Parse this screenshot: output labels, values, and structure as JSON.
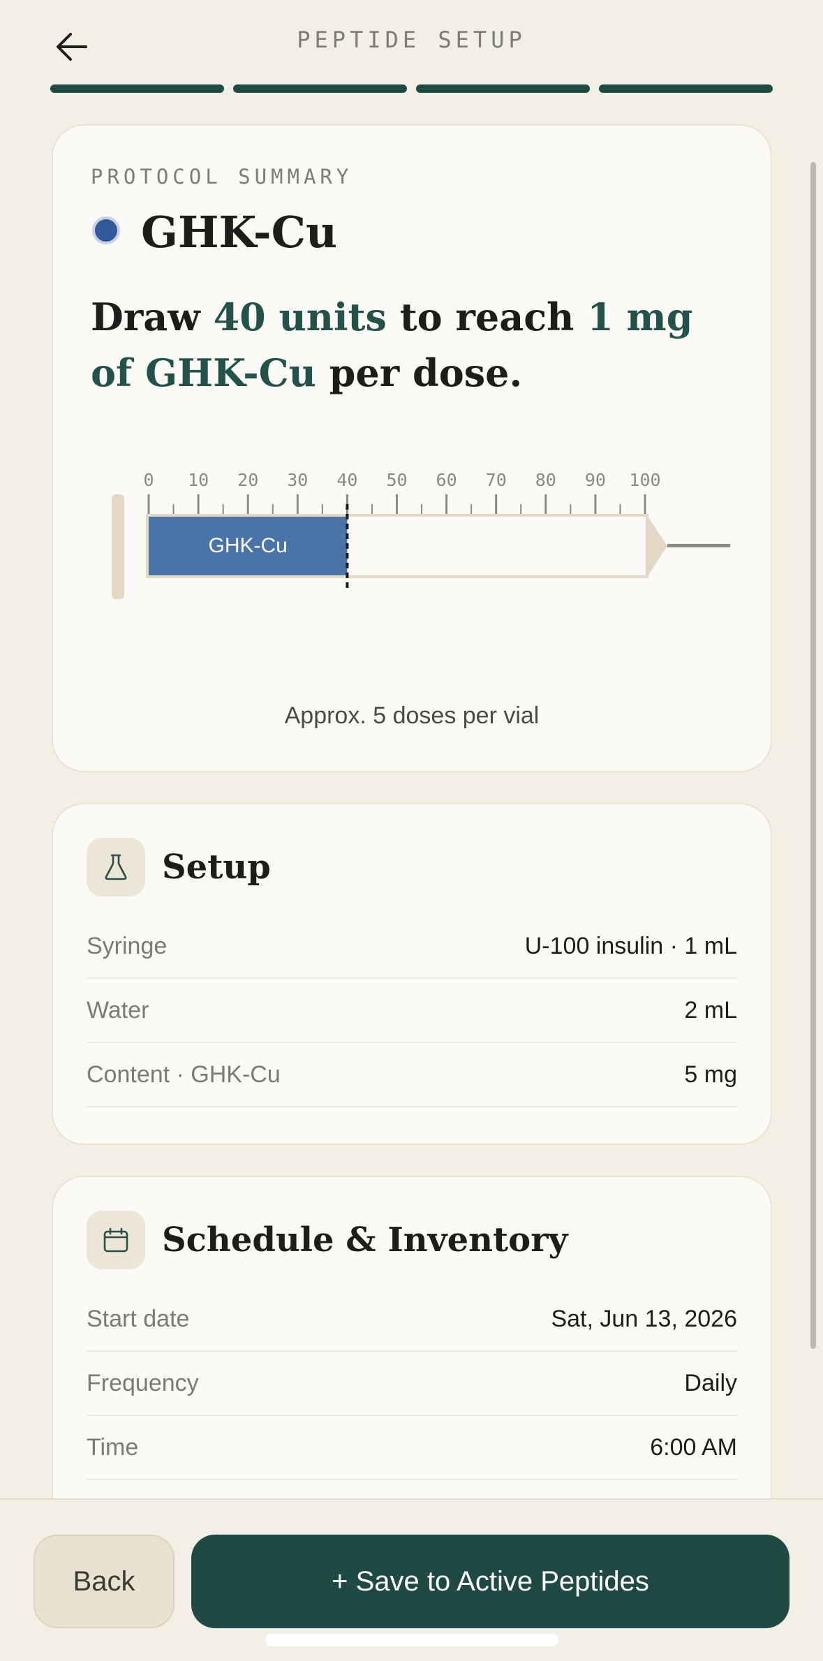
{
  "header": {
    "back_icon": "arrow-left-icon",
    "title": "PEPTIDE SETUP",
    "progress_steps": 4,
    "progress_completed": 4
  },
  "summary": {
    "eyebrow": "PROTOCOL SUMMARY",
    "peptide_name": "GHK-Cu",
    "peptide_color": "#31599b",
    "instruction": {
      "pre": "Draw ",
      "units": "40 units",
      "mid": " to reach ",
      "dose": "1 mg of GHK-Cu",
      "post": " per dose."
    },
    "syringe": {
      "tick_labels": [
        "0",
        "10",
        "20",
        "30",
        "40",
        "50",
        "60",
        "70",
        "80",
        "90",
        "100"
      ],
      "max_units": 100,
      "fill_units": 40,
      "fill_label": "GHK-Cu"
    },
    "approx_doses": "Approx. 5 doses per vial"
  },
  "setup": {
    "icon": "flask-icon",
    "title": "Setup",
    "rows": [
      {
        "label": "Syringe",
        "value": "U-100 insulin · 1 mL"
      },
      {
        "label": "Water",
        "value": "2 mL"
      },
      {
        "label": "Content · GHK-Cu",
        "value": "5 mg"
      }
    ]
  },
  "schedule": {
    "icon": "calendar-icon",
    "title": "Schedule & Inventory",
    "rows": [
      {
        "label": "Start date",
        "value": "Sat, Jun 13, 2026"
      },
      {
        "label": "Frequency",
        "value": "Daily"
      },
      {
        "label": "Time",
        "value": "6:00 AM"
      }
    ]
  },
  "footer": {
    "back_label": "Back",
    "save_label": "+ Save to Active Peptides"
  },
  "colors": {
    "accent": "#1f4a43",
    "background": "#f2efe5",
    "card": "#fbfaf6",
    "fill": "#4a74a8"
  }
}
